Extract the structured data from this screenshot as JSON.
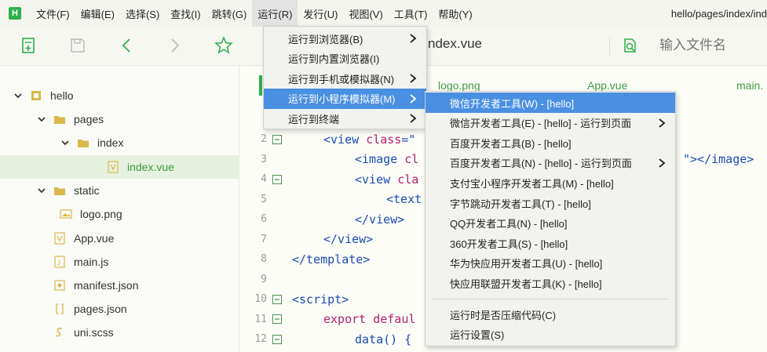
{
  "menubar": {
    "logo": "H",
    "items": [
      "文件(F)",
      "编辑(E)",
      "选择(S)",
      "查找(I)",
      "跳转(G)",
      "运行(R)",
      "发行(U)",
      "视图(V)",
      "工具(T)",
      "帮助(Y)"
    ],
    "active_index": 5,
    "path": "hello/pages/index/ind"
  },
  "toolbar": {
    "tab_title": "ndex.vue",
    "search_placeholder": "输入文件名"
  },
  "sidebar": {
    "items": [
      {
        "label": "hello",
        "icon": "project-icon",
        "level": 0,
        "expanded": true
      },
      {
        "label": "pages",
        "icon": "folder-icon",
        "level": 1,
        "expanded": true
      },
      {
        "label": "index",
        "icon": "folder-icon",
        "level": 2,
        "expanded": true
      },
      {
        "label": "index.vue",
        "icon": "vue-file-icon",
        "level": 3,
        "selected": true
      },
      {
        "label": "static",
        "icon": "folder-icon",
        "level": 1,
        "expanded": true
      },
      {
        "label": "logo.png",
        "icon": "image-file-icon",
        "level": 2
      },
      {
        "label": "App.vue",
        "icon": "vue-file-icon",
        "level": 1
      },
      {
        "label": "main.js",
        "icon": "js-file-icon",
        "level": 1
      },
      {
        "label": "manifest.json",
        "icon": "manifest-file-icon",
        "level": 1
      },
      {
        "label": "pages.json",
        "icon": "json-file-icon",
        "level": 1
      },
      {
        "label": "uni.scss",
        "icon": "scss-file-icon",
        "level": 1
      }
    ]
  },
  "editor": {
    "tabs": [
      "logo.png",
      "App.vue",
      "main."
    ],
    "lines": [
      {
        "num": "2",
        "fold": true,
        "indent": 1,
        "parts": [
          [
            "tag",
            "<view "
          ],
          [
            "kw",
            "class"
          ],
          [
            "tag",
            "=\""
          ]
        ]
      },
      {
        "num": "3",
        "fold": false,
        "indent": 2,
        "parts": [
          [
            "tag",
            "<image "
          ],
          [
            "kw",
            "cl"
          ]
        ]
      },
      {
        "num": "4",
        "fold": true,
        "indent": 2,
        "parts": [
          [
            "tag",
            "<view "
          ],
          [
            "kw",
            "cla"
          ]
        ]
      },
      {
        "num": "5",
        "fold": false,
        "indent": 3,
        "parts": [
          [
            "tag",
            "<text"
          ]
        ]
      },
      {
        "num": "6",
        "fold": false,
        "indent": 2,
        "parts": [
          [
            "tag",
            "</view>"
          ]
        ]
      },
      {
        "num": "7",
        "fold": false,
        "indent": 1,
        "parts": [
          [
            "tag",
            "</view>"
          ]
        ]
      },
      {
        "num": "8",
        "fold": false,
        "indent": 0,
        "parts": [
          [
            "tag",
            "</template>"
          ]
        ]
      },
      {
        "num": "9",
        "fold": false,
        "indent": 0,
        "parts": []
      },
      {
        "num": "10",
        "fold": true,
        "indent": 0,
        "parts": [
          [
            "tag",
            "<script>"
          ]
        ]
      },
      {
        "num": "11",
        "fold": true,
        "indent": 1,
        "parts": [
          [
            "kw",
            "export "
          ],
          [
            "kw",
            "defaul"
          ]
        ]
      },
      {
        "num": "12",
        "fold": true,
        "indent": 2,
        "parts": [
          [
            "plain",
            "data() {"
          ]
        ]
      }
    ],
    "right_fragment": "\"></image>"
  },
  "run_menu": {
    "items": [
      {
        "label": "运行到浏览器(B)",
        "arrow": true
      },
      {
        "label": "运行到内置浏览器(I)",
        "arrow": false
      },
      {
        "label": "运行到手机或模拟器(N)",
        "arrow": true
      },
      {
        "label": "运行到小程序模拟器(M)",
        "arrow": true,
        "highlighted": true
      },
      {
        "label": "运行到终端",
        "arrow": true
      }
    ]
  },
  "mp_menu": {
    "items": [
      {
        "label": "微信开发者工具(W) - [hello]",
        "arrow": false,
        "highlighted": true
      },
      {
        "label": "微信开发者工具(E) - [hello] - 运行到页面",
        "arrow": true
      },
      {
        "label": "百度开发者工具(B) - [hello]",
        "arrow": false
      },
      {
        "label": "百度开发者工具(N) - [hello] - 运行到页面",
        "arrow": true
      },
      {
        "label": "支付宝小程序开发者工具(M) - [hello]",
        "arrow": false
      },
      {
        "label": "字节跳动开发者工具(T) - [hello]",
        "arrow": false
      },
      {
        "label": "QQ开发者工具(N) - [hello]",
        "arrow": false
      },
      {
        "label": "360开发者工具(S) - [hello]",
        "arrow": false
      },
      {
        "label": "华为快应用开发者工具(U) - [hello]",
        "arrow": false
      },
      {
        "label": "快应用联盟开发者工具(K) - [hello]",
        "arrow": false
      }
    ],
    "extra_items": [
      {
        "label": "运行时是否压缩代码(C)"
      },
      {
        "label": "运行设置(S)"
      }
    ]
  },
  "colors": {
    "accent_green": "#2db04b",
    "highlight_blue": "#4a90e2",
    "selected_row": "#e6f2df",
    "tag_blue": "#1a4bb5",
    "keyword_magenta": "#b01e6e"
  }
}
